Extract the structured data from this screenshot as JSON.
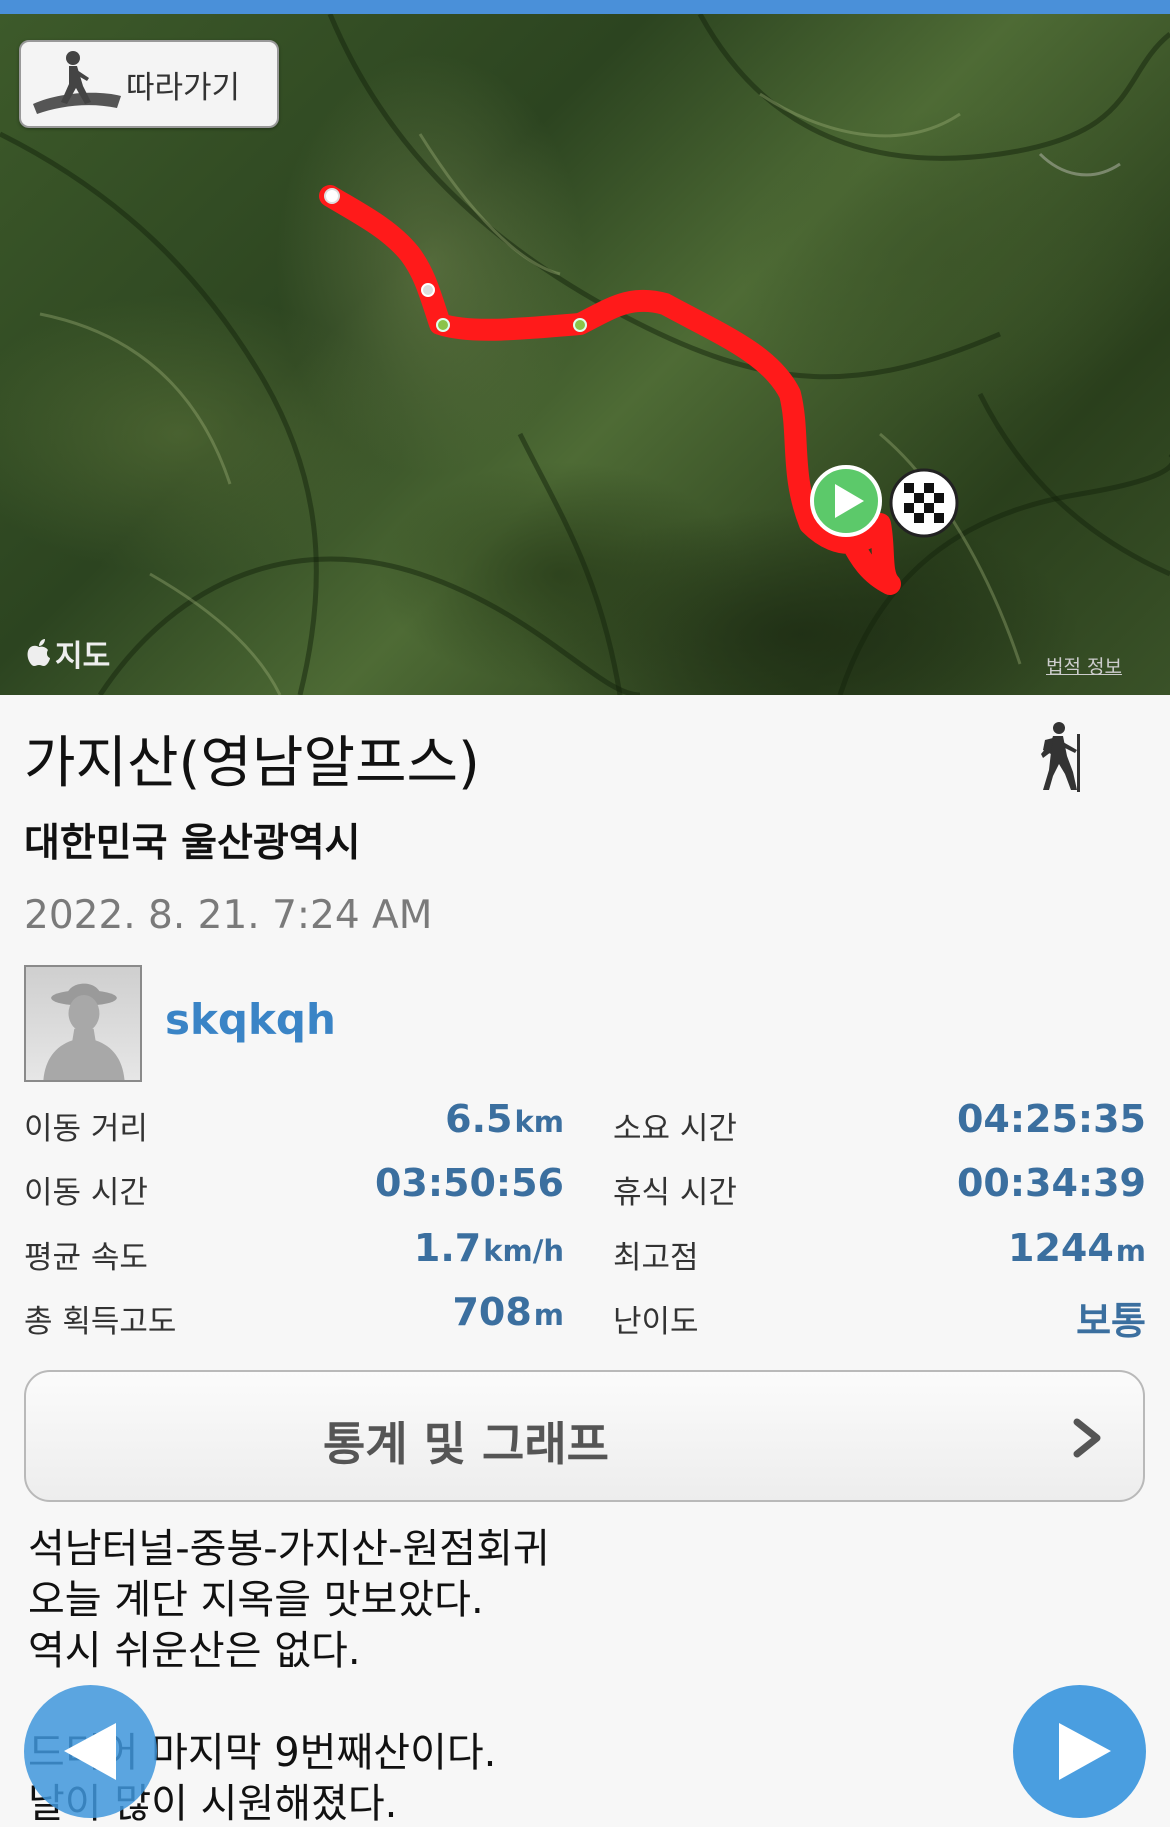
{
  "follow_button": {
    "label": "따라가기"
  },
  "map": {
    "brand": "지도",
    "legal_link": "법적 정보",
    "route_color": "#ff1a1a"
  },
  "trail": {
    "title": "가지산(영남알프스)",
    "location": "대한민국 울산광역시",
    "datetime": "2022. 8. 21. 7:24 AM",
    "activity_icon": "hiker-icon"
  },
  "user": {
    "name": "skqkqh",
    "avatar_icon": "person-silhouette-icon"
  },
  "stats": {
    "distance": {
      "label": "이동 거리",
      "value": "6.5",
      "unit": "km"
    },
    "duration": {
      "label": "소요 시간",
      "value": "04:25:35"
    },
    "moving_time": {
      "label": "이동 시간",
      "value": "03:50:56"
    },
    "rest_time": {
      "label": "휴식 시간",
      "value": "00:34:39"
    },
    "avg_speed": {
      "label": "평균 속도",
      "value": "1.7",
      "unit": "km/h"
    },
    "max_altitude": {
      "label": "최고점",
      "value": "1244",
      "unit": "m"
    },
    "elevation_gain": {
      "label": "총 획득고도",
      "value": "708",
      "unit": "m"
    },
    "difficulty": {
      "label": "난이도",
      "value": "보통"
    }
  },
  "stats_button": {
    "label": "통계 및 그래프",
    "icon": "chevron-right-icon"
  },
  "notes": [
    "석남터널-중봉-가지산-원점회귀",
    "오늘 계단 지옥을 맛보았다.",
    "역시 쉬운산은 없다.",
    "",
    "드디어 마지막 9번째산이다.",
    "날이 많이 시원해졌다."
  ],
  "nav": {
    "prev_icon": "arrow-left-icon",
    "next_icon": "arrow-right-icon",
    "accent": "#4a9ee0"
  }
}
